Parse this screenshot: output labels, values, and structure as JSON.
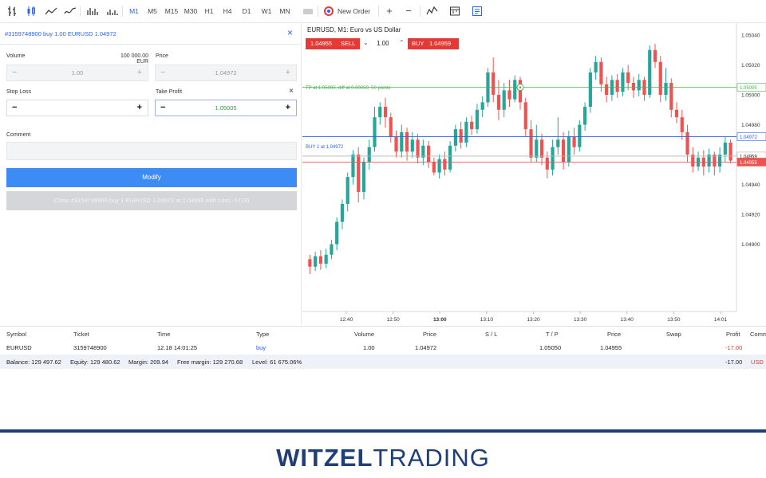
{
  "toolbar": {
    "timeframes": [
      "M1",
      "M5",
      "M15",
      "M30",
      "H1",
      "H4",
      "D1",
      "W1",
      "MN"
    ],
    "active_timeframe": "M1",
    "new_order_label": "New Order"
  },
  "order_panel": {
    "title": "#3159748900 buy 1.00 EURUSD 1.04972",
    "volume_label": "Volume",
    "volume_value": "1.00",
    "volume_unit": "100 000.00 EUR",
    "price_label": "Price",
    "price_value": "1.04972",
    "stop_loss_label": "Stop Loss",
    "stop_loss_value": "",
    "take_profit_label": "Take Profit",
    "take_profit_value": "1.05005",
    "comment_label": "Comment",
    "comment_value": "",
    "modify_label": "Modify",
    "close_label": "Close #3159748900 buy 1 EURUSD 1.04972 at 1.04955 with Loss -17.00"
  },
  "chart_header": {
    "title": "EURUSD, M1: Euro vs US Dollar",
    "sell_price": "1.04955",
    "sell_label": "SELL",
    "lot": "1.00",
    "buy_label": "BUY",
    "buy_price": "1.04959"
  },
  "chart_lines": {
    "tp_text": "TP at 1.05005, diff at 0.00050, 50 points",
    "buy_text": "BUY 1 at 1.04972",
    "tp_price": "1.05005",
    "buy_price": "1.04972",
    "ask_price": "1.04959",
    "bid_price": "1.04955"
  },
  "colors": {
    "up": "#26a69a",
    "down": "#ef5350",
    "tp": "#4caf50",
    "buy": "#2962ff",
    "accent": "#3d8bf5"
  },
  "chart_data": {
    "type": "candlestick",
    "title": "EURUSD, M1: Euro vs US Dollar",
    "ylim": [
      1.04855,
      1.05048
    ],
    "yticks": [
      "1.05040",
      "1.05020",
      "1.05000",
      "1.04980",
      "1.04960",
      "1.04940",
      "1.04920",
      "1.04900"
    ],
    "xticks": [
      "12:40",
      "12:50",
      "13:00",
      "13:10",
      "13:20",
      "13:30",
      "13:40",
      "13:50",
      "14:01"
    ],
    "series": [
      {
        "o": 1.0489,
        "c": 1.04885,
        "h": 1.04893,
        "l": 1.0488
      },
      {
        "o": 1.04885,
        "c": 1.04892,
        "h": 1.04895,
        "l": 1.04882
      },
      {
        "o": 1.04892,
        "c": 1.04887,
        "h": 1.04896,
        "l": 1.04883
      },
      {
        "o": 1.04887,
        "c": 1.04893,
        "h": 1.04897,
        "l": 1.04884
      },
      {
        "o": 1.04893,
        "c": 1.049,
        "h": 1.04903,
        "l": 1.0489
      },
      {
        "o": 1.049,
        "c": 1.04915,
        "h": 1.04918,
        "l": 1.04896
      },
      {
        "o": 1.04915,
        "c": 1.04927,
        "h": 1.0493,
        "l": 1.0491
      },
      {
        "o": 1.04927,
        "c": 1.04945,
        "h": 1.04948,
        "l": 1.04922
      },
      {
        "o": 1.04945,
        "c": 1.0496,
        "h": 1.04963,
        "l": 1.0494
      },
      {
        "o": 1.0496,
        "c": 1.04935,
        "h": 1.04965,
        "l": 1.04928
      },
      {
        "o": 1.04935,
        "c": 1.04955,
        "h": 1.04958,
        "l": 1.0493
      },
      {
        "o": 1.04955,
        "c": 1.04965,
        "h": 1.0497,
        "l": 1.0495
      },
      {
        "o": 1.04965,
        "c": 1.04985,
        "h": 1.04992,
        "l": 1.04962
      },
      {
        "o": 1.04985,
        "c": 1.04992,
        "h": 1.04995,
        "l": 1.0498
      },
      {
        "o": 1.04992,
        "c": 1.04985,
        "h": 1.04998,
        "l": 1.04978
      },
      {
        "o": 1.04985,
        "c": 1.04972,
        "h": 1.04988,
        "l": 1.04968
      },
      {
        "o": 1.04972,
        "c": 1.04962,
        "h": 1.04976,
        "l": 1.04958
      },
      {
        "o": 1.04962,
        "c": 1.04975,
        "h": 1.0498,
        "l": 1.04958
      },
      {
        "o": 1.04975,
        "c": 1.04962,
        "h": 1.04978,
        "l": 1.04956
      },
      {
        "o": 1.04962,
        "c": 1.0497,
        "h": 1.04975,
        "l": 1.04958
      },
      {
        "o": 1.0497,
        "c": 1.04958,
        "h": 1.04974,
        "l": 1.04954
      },
      {
        "o": 1.04958,
        "c": 1.04966,
        "h": 1.0497,
        "l": 1.04953
      },
      {
        "o": 1.04966,
        "c": 1.04955,
        "h": 1.04969,
        "l": 1.04951
      },
      {
        "o": 1.04955,
        "c": 1.04948,
        "h": 1.04958,
        "l": 1.04946
      },
      {
        "o": 1.04948,
        "c": 1.04957,
        "h": 1.0496,
        "l": 1.04944
      },
      {
        "o": 1.04957,
        "c": 1.0495,
        "h": 1.04962,
        "l": 1.04946
      },
      {
        "o": 1.0495,
        "c": 1.04966,
        "h": 1.04969,
        "l": 1.04948
      },
      {
        "o": 1.04966,
        "c": 1.04977,
        "h": 1.0498,
        "l": 1.04962
      },
      {
        "o": 1.04977,
        "c": 1.04968,
        "h": 1.04982,
        "l": 1.04964
      },
      {
        "o": 1.04968,
        "c": 1.04982,
        "h": 1.04985,
        "l": 1.04965
      },
      {
        "o": 1.04982,
        "c": 1.04977,
        "h": 1.04986,
        "l": 1.04973
      },
      {
        "o": 1.04977,
        "c": 1.0499,
        "h": 1.04994,
        "l": 1.04974
      },
      {
        "o": 1.0499,
        "c": 1.04995,
        "h": 1.04999,
        "l": 1.04985
      },
      {
        "o": 1.04995,
        "c": 1.05015,
        "h": 1.05018,
        "l": 1.04992
      },
      {
        "o": 1.05015,
        "c": 1.05,
        "h": 1.05025,
        "l": 1.04995
      },
      {
        "o": 1.05,
        "c": 1.0499,
        "h": 1.0501,
        "l": 1.04983
      },
      {
        "o": 1.0499,
        "c": 1.05003,
        "h": 1.05008,
        "l": 1.04985
      },
      {
        "o": 1.05003,
        "c": 1.04997,
        "h": 1.0501,
        "l": 1.04992
      },
      {
        "o": 1.04997,
        "c": 1.0501,
        "h": 1.05013,
        "l": 1.04995
      },
      {
        "o": 1.0501,
        "c": 1.04995,
        "h": 1.05012,
        "l": 1.0499
      },
      {
        "o": 1.04995,
        "c": 1.04977,
        "h": 1.04998,
        "l": 1.04972
      },
      {
        "o": 1.04977,
        "c": 1.04958,
        "h": 1.04983,
        "l": 1.04955
      },
      {
        "o": 1.04958,
        "c": 1.0497,
        "h": 1.0498,
        "l": 1.04955
      },
      {
        "o": 1.0497,
        "c": 1.04958,
        "h": 1.04974,
        "l": 1.04953
      },
      {
        "o": 1.04958,
        "c": 1.0495,
        "h": 1.04962,
        "l": 1.04944
      },
      {
        "o": 1.0495,
        "c": 1.04965,
        "h": 1.0497,
        "l": 1.04946
      },
      {
        "o": 1.04965,
        "c": 1.0497,
        "h": 1.04985,
        "l": 1.0496
      },
      {
        "o": 1.0497,
        "c": 1.04955,
        "h": 1.04975,
        "l": 1.0495
      },
      {
        "o": 1.04955,
        "c": 1.04972,
        "h": 1.04976,
        "l": 1.04952
      },
      {
        "o": 1.04972,
        "c": 1.04965,
        "h": 1.04978,
        "l": 1.0496
      },
      {
        "o": 1.04965,
        "c": 1.0498,
        "h": 1.04983,
        "l": 1.04962
      },
      {
        "o": 1.0498,
        "c": 1.04992,
        "h": 1.04995,
        "l": 1.04976
      },
      {
        "o": 1.04992,
        "c": 1.05015,
        "h": 1.05018,
        "l": 1.04988
      },
      {
        "o": 1.05015,
        "c": 1.05022,
        "h": 1.05026,
        "l": 1.0501
      },
      {
        "o": 1.05022,
        "c": 1.05007,
        "h": 1.05025,
        "l": 1.05002
      },
      {
        "o": 1.05007,
        "c": 1.05,
        "h": 1.05012,
        "l": 1.04995
      },
      {
        "o": 1.05,
        "c": 1.0501,
        "h": 1.05013,
        "l": 1.04996
      },
      {
        "o": 1.0501,
        "c": 1.05002,
        "h": 1.05014,
        "l": 1.04998
      },
      {
        "o": 1.05002,
        "c": 1.05015,
        "h": 1.05018,
        "l": 1.04999
      },
      {
        "o": 1.05015,
        "c": 1.05008,
        "h": 1.0502,
        "l": 1.05003
      },
      {
        "o": 1.05008,
        "c": 1.05003,
        "h": 1.05012,
        "l": 1.04998
      },
      {
        "o": 1.05003,
        "c": 1.0501,
        "h": 1.05014,
        "l": 1.04999
      },
      {
        "o": 1.0501,
        "c": 1.05,
        "h": 1.05012,
        "l": 1.04996
      },
      {
        "o": 1.05,
        "c": 1.0503,
        "h": 1.05033,
        "l": 1.04998
      },
      {
        "o": 1.0503,
        "c": 1.05022,
        "h": 1.05034,
        "l": 1.05018
      },
      {
        "o": 1.05022,
        "c": 1.05,
        "h": 1.05026,
        "l": 1.04995
      },
      {
        "o": 1.05,
        "c": 1.05008,
        "h": 1.05018,
        "l": 1.04996
      },
      {
        "o": 1.05008,
        "c": 1.0499,
        "h": 1.05011,
        "l": 1.04985
      },
      {
        "o": 1.0499,
        "c": 1.04985,
        "h": 1.04995,
        "l": 1.04981
      },
      {
        "o": 1.04985,
        "c": 1.04975,
        "h": 1.0499,
        "l": 1.0497
      },
      {
        "o": 1.04975,
        "c": 1.0496,
        "h": 1.0498,
        "l": 1.04955
      },
      {
        "o": 1.0496,
        "c": 1.04952,
        "h": 1.04965,
        "l": 1.04948
      },
      {
        "o": 1.04952,
        "c": 1.04958,
        "h": 1.04962,
        "l": 1.04949
      },
      {
        "o": 1.04958,
        "c": 1.04952,
        "h": 1.04963,
        "l": 1.04946
      },
      {
        "o": 1.04952,
        "c": 1.0496,
        "h": 1.04964,
        "l": 1.04948
      },
      {
        "o": 1.0496,
        "c": 1.04952,
        "h": 1.04962,
        "l": 1.04946
      },
      {
        "o": 1.04952,
        "c": 1.0496,
        "h": 1.04965,
        "l": 1.04948
      },
      {
        "o": 1.0496,
        "c": 1.04968,
        "h": 1.04972,
        "l": 1.04955
      },
      {
        "o": 1.04968,
        "c": 1.04956,
        "h": 1.0497,
        "l": 1.04954
      }
    ]
  },
  "positions": {
    "headers": [
      "Symbol",
      "Ticket",
      "Time",
      "Type",
      "Volume",
      "Price",
      "S / L",
      "T / P",
      "Price",
      "Swap",
      "Profit",
      "Comm"
    ],
    "row": [
      "EURUSD",
      "3159748900",
      "12.18 14:01:25",
      "buy",
      "1.00",
      "1.04972",
      "",
      "1.05050",
      "1.04955",
      "",
      "-17.00",
      ""
    ],
    "summary": {
      "balance": "Balance: 129 497.62",
      "equity": "Equity: 129 480.62",
      "margin": "Margin: 209.94",
      "free_margin": "Free margin: 129 270.68",
      "level": "Level: 61 675.06%",
      "total": "-17.00",
      "currency": "USD"
    }
  },
  "footer": {
    "brand_bold": "WITZEL",
    "brand_light": "TRADING"
  }
}
